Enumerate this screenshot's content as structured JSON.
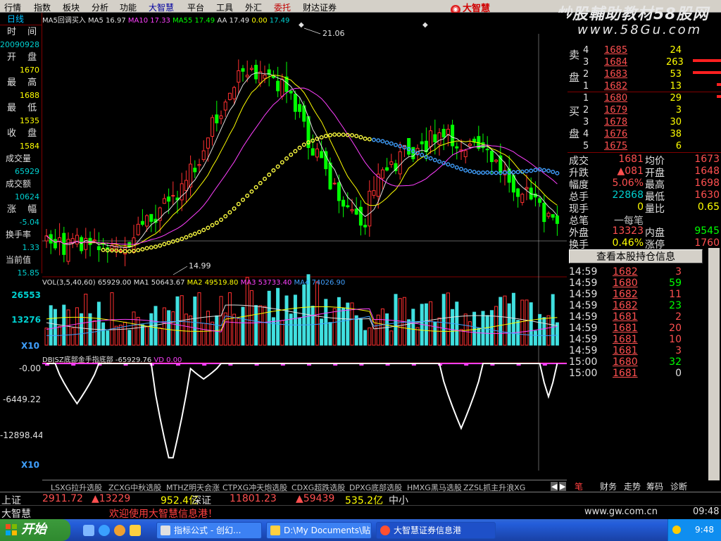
{
  "menu": [
    "行情",
    "指数",
    "板块",
    "分析",
    "功能",
    "大智慧",
    "平台",
    "工具",
    "外汇",
    "委托",
    "财达证券"
  ],
  "brand": "大智慧",
  "watermark": {
    "line1": "炒股輔助教材58股网",
    "line2": "www.58Gu.com"
  },
  "left_panel": {
    "tab": "日线",
    "date_label": "时  间",
    "date": "20090928",
    "open_label": "开 盘",
    "open": "1670",
    "high_label": "最 高",
    "high": "1688",
    "low_label": "最 低",
    "low": "1535",
    "close_label": "收 盘",
    "close": "1584",
    "volume_label": "成交量",
    "volume": "65929",
    "amount_label": "成交额",
    "amount": "10624",
    "change_label": "涨 幅",
    "change": "-5.04",
    "turnover_label": "换手率",
    "turnover": "1.33",
    "current_label": "当前值",
    "current": "15.85"
  },
  "price_chart": {
    "legend": {
      "name": "MA5回调买入",
      "ma5_label": "MA5",
      "ma5": "16.97",
      "ma10_label": "MA10",
      "ma10": "17.33",
      "ma55_label": "MA55",
      "ma55": "17.49",
      "aa_label": "AA",
      "aa": "17.49",
      "zero": "0.00",
      "last": "17.49"
    },
    "high_marker": "21.06",
    "low_marker": "14.99"
  },
  "volume_chart": {
    "legend": {
      "name": "VOL(3,5,40,60)",
      "vol": "65929.00",
      "ma1_label": "MA1",
      "ma1": "50643.67",
      "ma2_label": "MA2",
      "ma2": "49519.80",
      "ma3_label": "MA3",
      "ma3": "53733.40",
      "ma4_label": "MA4",
      "ma4": "74026.90"
    },
    "y_top": "26553",
    "y_mid": "13276",
    "scale": "X10"
  },
  "indicator_chart": {
    "legend": {
      "name": "DBJSZ底部金手指底部",
      "value": "-65929.76",
      "vd_label": "VD",
      "vd": "0.00"
    },
    "y_top": "-0.00",
    "y_mid": "-6449.22",
    "y_low": "-12898.44",
    "scale": "X10"
  },
  "order_book": {
    "sell_label": [
      "卖",
      "盘"
    ],
    "buy_label": [
      "买",
      "盘"
    ],
    "sell": [
      {
        "level": "4",
        "price": "1685",
        "vol": "24"
      },
      {
        "level": "3",
        "price": "1684",
        "vol": "263"
      },
      {
        "level": "2",
        "price": "1683",
        "vol": "53"
      },
      {
        "level": "1",
        "price": "1682",
        "vol": "13"
      }
    ],
    "buy": [
      {
        "level": "1",
        "price": "1680",
        "vol": "29"
      },
      {
        "level": "2",
        "price": "1679",
        "vol": "3"
      },
      {
        "level": "3",
        "price": "1678",
        "vol": "30"
      },
      {
        "level": "4",
        "price": "1676",
        "vol": "38"
      },
      {
        "level": "5",
        "price": "1675",
        "vol": "6"
      }
    ]
  },
  "stats": {
    "deal_label": "成交",
    "deal": "1681",
    "avg_label": "均价",
    "avg": "1673",
    "chg_label": "升跌",
    "chg": "▲081",
    "open_label": "开盘",
    "open": "1648",
    "amp_label": "幅度",
    "amp": "5.06%",
    "high_label": "最高",
    "high": "1698",
    "total_label": "总手",
    "total": "22868",
    "low_label": "最低",
    "low": "1630",
    "now_label": "现手",
    "now": "0",
    "vr_label": "量比",
    "vr": "0.65",
    "lot_label": "总笔",
    "lot": "一每笔",
    "lot2": "",
    "outer_label": "外盘",
    "outer": "13323",
    "inner_label": "内盘",
    "inner": "9545",
    "turn_label": "换手",
    "turn": "0.46%",
    "limit_label": "涨停",
    "limit": "1760"
  },
  "holding_button": "查看本股持仓信息",
  "ticks": [
    {
      "t": "14:59",
      "p": "1682",
      "v": "3",
      "pc": "red",
      "vc": "red"
    },
    {
      "t": "14:59",
      "p": "1680",
      "v": "59",
      "pc": "red",
      "vc": "green"
    },
    {
      "t": "14:59",
      "p": "1682",
      "v": "11",
      "pc": "red",
      "vc": "red"
    },
    {
      "t": "14:59",
      "p": "1682",
      "v": "23",
      "pc": "red",
      "vc": "green"
    },
    {
      "t": "14:59",
      "p": "1681",
      "v": "2",
      "pc": "red",
      "vc": "red"
    },
    {
      "t": "14:59",
      "p": "1681",
      "v": "20",
      "pc": "red",
      "vc": "red"
    },
    {
      "t": "14:59",
      "p": "1681",
      "v": "10",
      "pc": "red",
      "vc": "red"
    },
    {
      "t": "14:59",
      "p": "1681",
      "v": "3",
      "pc": "red",
      "vc": "red"
    },
    {
      "t": "15:00",
      "p": "1680",
      "v": "32",
      "pc": "red",
      "vc": "green"
    },
    {
      "t": "15:00",
      "p": "1681",
      "v": "0",
      "pc": "red",
      "vc": "white"
    }
  ],
  "formula_tabs": [
    "LSXG拉升选股",
    "ZCXG中秋选股",
    "MTHZ明天会涨",
    "CTPXG冲天炮选股",
    "CDXG超跌选股",
    "DPXG底部选股",
    "HMXG黑马选股",
    "ZZSL抓主升浪XG"
  ],
  "right_tabs": [
    "笔",
    "财务",
    "走势",
    "筹码",
    "诊断"
  ],
  "index_bar": {
    "sh_label": "上证",
    "sh": "2911.72",
    "sh_chg": "▲13229",
    "sh_amt": "952.4亿",
    "sz_label": "深证",
    "sz": "11801.23",
    "sz_chg": "▲59439",
    "sz_amt": "535.2亿",
    "sme": "中小"
  },
  "status_bar": {
    "brand": "大智慧",
    "welcome": "欢迎使用大智慧信息港！",
    "site": "www.gw.com.cn",
    "time": "09:48"
  },
  "taskbar": {
    "start": "开始",
    "buttons": [
      "指标公式 - 创幻...",
      "D:\\My Documents\\贴...",
      "大智慧证券信息港"
    ],
    "clock": "9:48"
  }
}
